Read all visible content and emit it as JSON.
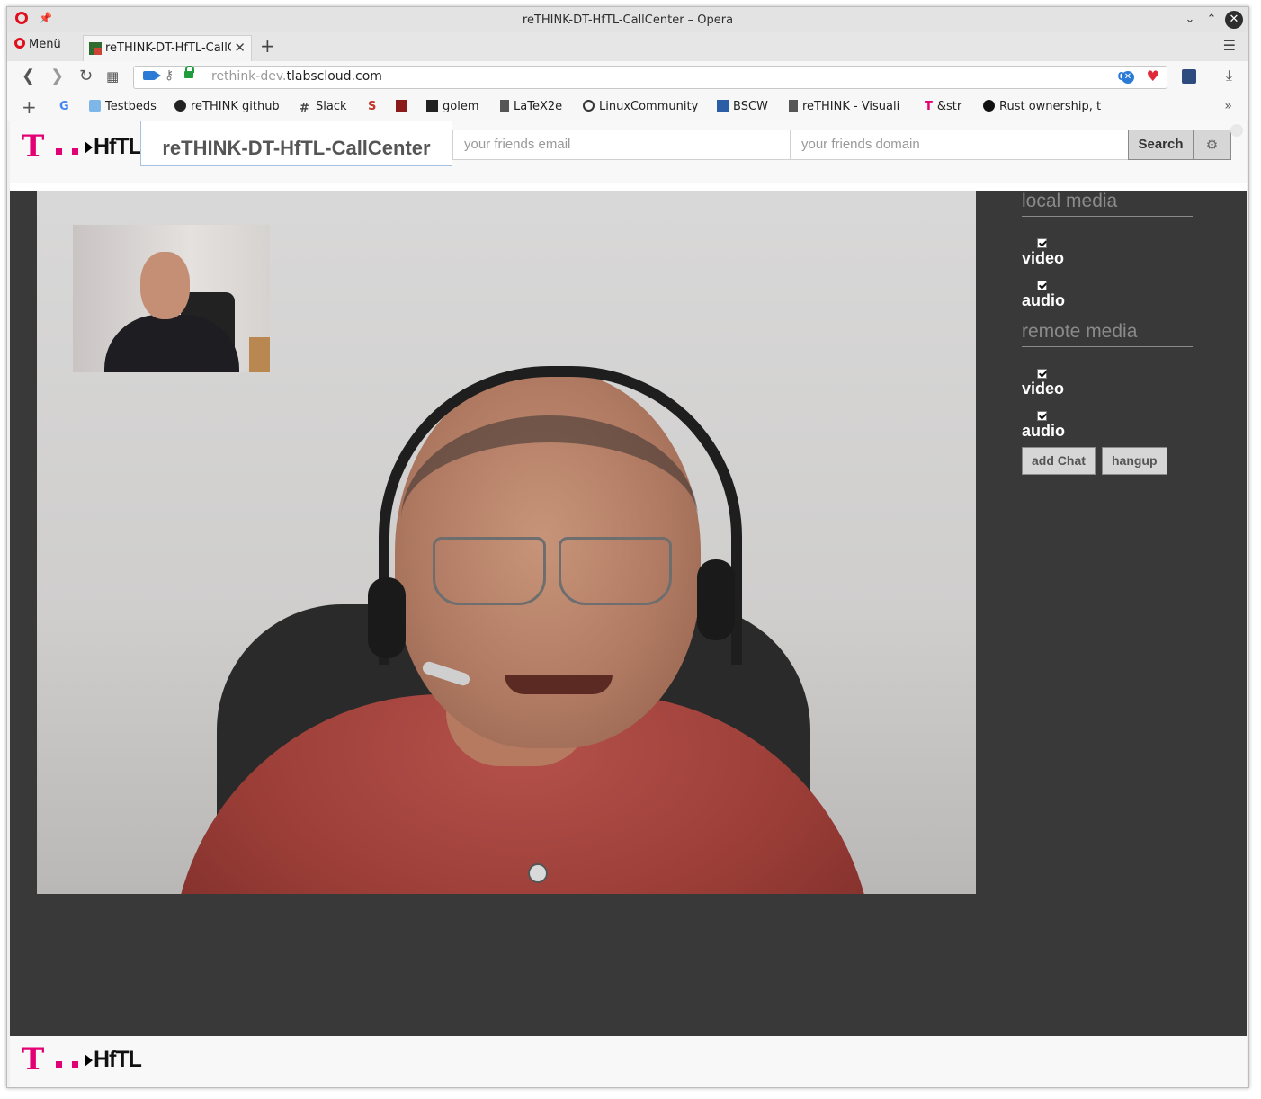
{
  "window": {
    "title": "reTHINK-DT-HfTL-CallCenter – Opera"
  },
  "tabs": {
    "menu_label": "Menü",
    "active_tab_label": "reTHINK-DT-HfTL-CallCenter",
    "new_tab_symbol": "+"
  },
  "address": {
    "url_sub": "rethink-dev.",
    "url_domain": "tlabscloud.com",
    "badge_count": "0"
  },
  "bookmarks": [
    {
      "label": "Testbeds",
      "icon": "folder-icon"
    },
    {
      "label": "reTHINK github",
      "icon": "github-icon"
    },
    {
      "label": "Slack",
      "icon": "slack-icon"
    },
    {
      "label": "",
      "icon": "s-logo-icon"
    },
    {
      "label": "",
      "icon": "h-logo-icon"
    },
    {
      "label": "golem",
      "icon": "golem-icon"
    },
    {
      "label": "LaTeX2e",
      "icon": "document-icon"
    },
    {
      "label": "LinuxCommunity",
      "icon": "linuxcommunity-icon"
    },
    {
      "label": "BSCW",
      "icon": "bscw-icon"
    },
    {
      "label": "reTHINK - Visuali",
      "icon": "document-icon"
    },
    {
      "label": "&str",
      "icon": "telekom-icon"
    },
    {
      "label": "Rust ownership, t",
      "icon": "cm-icon"
    }
  ],
  "app": {
    "brand": "HfTL",
    "title": "reTHINK-DT-HfTL-CallCenter",
    "email_placeholder": "your friends email",
    "domain_placeholder": "your friends domain",
    "search_label": "Search",
    "gear_icon": "gear-icon"
  },
  "side": {
    "local_media_title": "local media",
    "remote_media_title": "remote media",
    "local_video_label": "video",
    "local_audio_label": "audio",
    "remote_video_label": "video",
    "remote_audio_label": "audio",
    "local_video_checked": true,
    "local_audio_checked": true,
    "remote_video_checked": true,
    "remote_audio_checked": true,
    "add_chat_label": "add Chat",
    "hangup_label": "hangup"
  },
  "footer": {
    "brand": "HfTL"
  },
  "colors": {
    "telekom_magenta": "#e20074",
    "main_background": "#393939",
    "opera_red": "#e10e1d"
  }
}
